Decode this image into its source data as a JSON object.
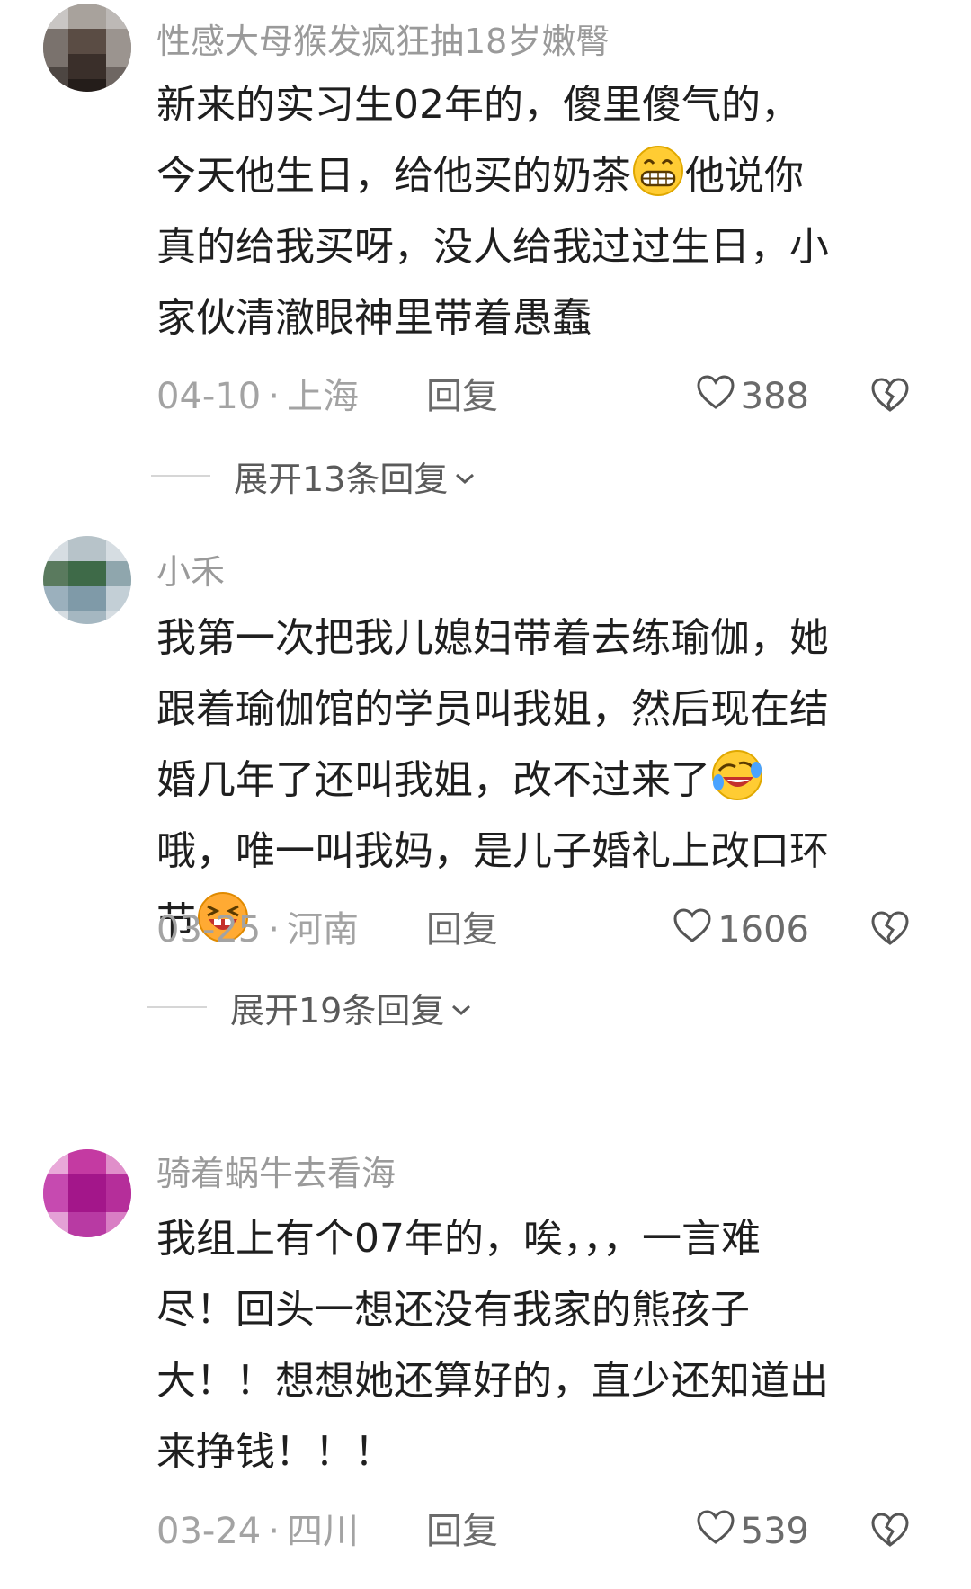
{
  "comments": [
    {
      "username": "性感大母猴发疯狂抽18岁嫩臀",
      "lines": [
        [
          "新来的实习生02年的，傻里傻气的，"
        ],
        [
          "今天他生日，给他买的奶茶",
          "他说你"
        ],
        [
          "真的给我买呀，没人给我过过生日，小"
        ],
        [
          "家伙清澈眼神里带着愚蠢"
        ]
      ],
      "emojis": [
        "grinning-face-emoji"
      ],
      "date": "04-10",
      "location": "上海",
      "reply_label": "回复",
      "likes": "388",
      "expand_label": "展开13条回复"
    },
    {
      "username": "小禾",
      "lines": [
        [
          "我第一次把我儿媳妇带着去练瑜伽，她"
        ],
        [
          "跟着瑜伽馆的学员叫我姐，然后现在结"
        ],
        [
          "婚几年了还叫我姐，改不过来了"
        ],
        [
          "哦，唯一叫我妈，是儿子婚礼上改口环"
        ],
        [
          "节"
        ]
      ],
      "emojis": [
        "rolling-laughing-emoji",
        "laughing-emoji"
      ],
      "date": "03-25",
      "location": "河南",
      "reply_label": "回复",
      "likes": "1606",
      "expand_label": "展开19条回复"
    },
    {
      "username": "骑着蜗牛去看海",
      "lines": [
        [
          "我组上有个07年的，唉，，，一言难"
        ],
        [
          "尽！回头一想还没有我家的熊孩子"
        ],
        [
          "大！！想想她还算好的，直少还知道出"
        ],
        [
          "来挣钱！！！"
        ]
      ],
      "emojis": [],
      "date": "03-24",
      "location": "四川",
      "reply_label": "回复",
      "likes": "539"
    }
  ],
  "colors": {
    "username": "#9a9a9a",
    "body_text": "#1f1f1f",
    "meta_text": "#a3a3a3",
    "reply_text": "#6b6b6b",
    "emoji_yellow": "#ffcc33"
  },
  "icons": [
    "heart-outline-icon",
    "broken-heart-icon",
    "chevron-down-icon"
  ]
}
